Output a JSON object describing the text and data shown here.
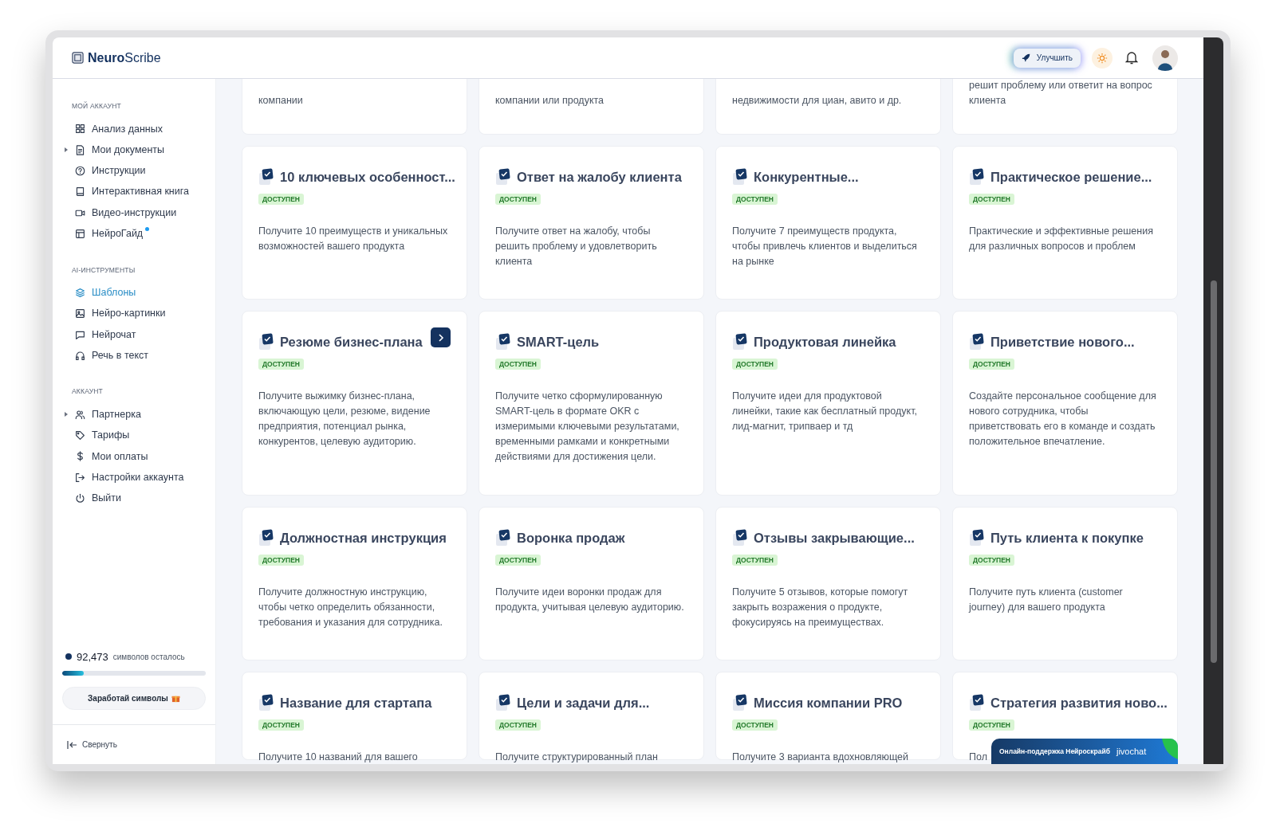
{
  "header": {
    "logo": "**Neuro**Scribe",
    "upgrade_button": "Улучшить"
  },
  "sidebar": {
    "sections": [
      {
        "title": "МОЙ АККАУНТ",
        "items": [
          {
            "label": "Анализ данных",
            "expandable": false,
            "new": false,
            "selected": false
          },
          {
            "label": "Мои документы",
            "expandable": true,
            "new": false,
            "selected": false
          },
          {
            "label": "Инструкции",
            "expandable": false,
            "new": false,
            "selected": false
          },
          {
            "label": "Интерактивная книга",
            "expandable": false,
            "new": false,
            "selected": false
          },
          {
            "label": "Видео-инструкции",
            "expandable": false,
            "new": false,
            "selected": false
          },
          {
            "label": "НейроГайд",
            "expandable": false,
            "new": true,
            "selected": false
          }
        ]
      },
      {
        "title": "AI-ИНСТРУМЕНТЫ",
        "items": [
          {
            "label": "Шаблоны",
            "expandable": false,
            "new": false,
            "selected": true
          },
          {
            "label": "Нейро-картинки",
            "expandable": false,
            "new": false,
            "selected": false
          },
          {
            "label": "Нейрочат",
            "expandable": false,
            "new": false,
            "selected": false
          },
          {
            "label": "Речь в текст",
            "expandable": false,
            "new": false,
            "selected": false
          }
        ]
      },
      {
        "title": "АККАУНТ",
        "items": [
          {
            "label": "Партнерка",
            "expandable": true,
            "new": false,
            "selected": false
          },
          {
            "label": "Тарифы",
            "expandable": false,
            "new": false,
            "selected": false
          },
          {
            "label": "Мои оплаты",
            "expandable": false,
            "new": false,
            "selected": false
          },
          {
            "label": "Настройки аккаунта",
            "expandable": false,
            "new": false,
            "selected": false
          },
          {
            "label": "Выйти",
            "expandable": false,
            "new": false,
            "selected": false
          }
        ]
      }
    ],
    "credits": {
      "count": "92,473",
      "label": "символов осталось",
      "level": 0.15
    },
    "earn_button": "Заработай символы",
    "collapse": "Свернуть"
  },
  "partial_cards": [
    {
      "description": "компании"
    },
    {
      "description": "компании или продукта"
    },
    {
      "description": "недвижимости для циан, авито и др."
    },
    {
      "description": "решит проблему или ответит на вопрос клиента"
    }
  ],
  "cards": [
    {
      "title": "10 ключевых особенност...",
      "status": "ДОСТУПЕН",
      "description": "Получите 10 преимуществ и уникальных возможностей вашего продукта",
      "action_button": false
    },
    {
      "title": "Ответ на жалобу клиента",
      "status": "ДОСТУПЕН",
      "description": "Получите ответ на жалобу, чтобы решить проблему и удовлетворить клиента",
      "action_button": false
    },
    {
      "title": "Конкурентные...",
      "status": "ДОСТУПЕН",
      "description": "Получите 7 преимуществ продукта, чтобы привлечь клиентов и выделиться на рынке",
      "action_button": false
    },
    {
      "title": "Практическое решение...",
      "status": "ДОСТУПЕН",
      "description": "Практические и эффективные решения для различных вопросов и проблем",
      "action_button": false
    },
    {
      "title": "Резюме бизнес-плана",
      "status": "ДОСТУПЕН",
      "description": "Получите выжимку бизнес-плана, включающую цели, резюме, видение предприятия, потенциал рынка, конкурентов, целевую аудиторию.",
      "action_button": true
    },
    {
      "title": "SMART-цель",
      "status": "ДОСТУПЕН",
      "description": "Получите четко сформулированную SMART-цель в формате OKR с измеримыми ключевыми результатами, временными рамками и конкретными действиями для достижения цели.",
      "action_button": false
    },
    {
      "title": "Продуктовая линейка",
      "status": "ДОСТУПЕН",
      "description": "Получите идеи для продуктовой линейки, такие как бесплатный продукт, лид-магнит, трипваер и тд",
      "action_button": false
    },
    {
      "title": "Приветствие нового...",
      "status": "ДОСТУПЕН",
      "description": "Создайте персональное сообщение для нового сотрудника, чтобы приветствовать его в команде и создать положительное впечатление.",
      "action_button": false
    },
    {
      "title": "Должностная инструкция",
      "status": "ДОСТУПЕН",
      "description": "Получите должностную инструкцию, чтобы четко определить обязанности, требования и указания для сотрудника.",
      "action_button": false
    },
    {
      "title": "Воронка продаж",
      "status": "ДОСТУПЕН",
      "description": "Получите идеи воронки продаж для продукта, учитывая целевую аудиторию.",
      "action_button": false
    },
    {
      "title": "Отзывы закрывающие...",
      "status": "ДОСТУПЕН",
      "description": "Получите 5 отзывов, которые помогут закрыть возражения о продукте, фокусируясь на преимуществах.",
      "action_button": false
    },
    {
      "title": "Путь клиента к покупке",
      "status": "ДОСТУПЕН",
      "description": "Получите путь клиента (customer journey) для вашего продукта",
      "action_button": false
    },
    {
      "title": "Название для стартапа",
      "status": "ДОСТУПЕН",
      "description": "Получите 10 названий для вашего",
      "action_button": false
    },
    {
      "title": "Цели и задачи для...",
      "status": "ДОСТУПЕН",
      "description": "Получите структурированный план",
      "action_button": false
    },
    {
      "title": "Миссия компании PRO",
      "status": "ДОСТУПЕН",
      "description": "Получите 3 варианта вдохновляющей",
      "action_button": false
    },
    {
      "title": "Стратегия развития ново...",
      "status": "ДОСТУПЕН",
      "description": "Пол",
      "action_button": false
    }
  ],
  "chat_widget": {
    "label": "Онлайн-поддержка Нейроскрайб",
    "brand": "jivochat"
  }
}
